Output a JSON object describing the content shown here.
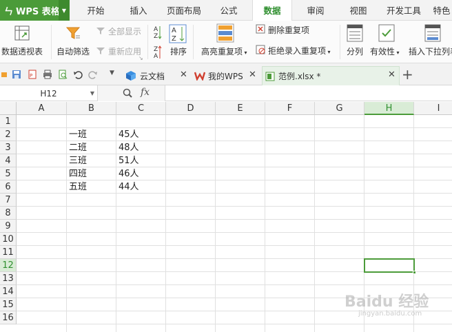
{
  "app": {
    "logo": "ㄣ",
    "name": "WPS 表格"
  },
  "menu": [
    "开始",
    "插入",
    "页面布局",
    "公式",
    "数据",
    "审阅",
    "视图",
    "开发工具",
    "特色"
  ],
  "ribbon": {
    "pivot": "数据透视表",
    "autofilter": "自动筛选",
    "show_all": "全部显示",
    "reapply": "重新应用",
    "sort": "排序",
    "highlight_dup": "高亮重复项",
    "remove_dup": "删除重复项",
    "reject_dup": "拒绝录入重复项",
    "split": "分列",
    "validity": "有效性",
    "insert_dropdown": "插入下拉列表"
  },
  "tabs": [
    {
      "label": "云文档"
    },
    {
      "label": "我的WPS"
    },
    {
      "label": "范例.xlsx *"
    }
  ],
  "formula_bar": {
    "name_box": "H12",
    "fx": "fx",
    "value": ""
  },
  "columns": [
    "A",
    "B",
    "C",
    "D",
    "E",
    "F",
    "G",
    "H",
    "I"
  ],
  "rows": [
    "1",
    "2",
    "3",
    "4",
    "5",
    "6",
    "7",
    "8",
    "9",
    "10",
    "11",
    "12",
    "13",
    "14",
    "15",
    "16"
  ],
  "cells": [
    {
      "ref": "B2",
      "value": "一班"
    },
    {
      "ref": "C2",
      "value": "45人"
    },
    {
      "ref": "B3",
      "value": "二班"
    },
    {
      "ref": "C3",
      "value": "48人"
    },
    {
      "ref": "B4",
      "value": "三班"
    },
    {
      "ref": "C4",
      "value": "51人"
    },
    {
      "ref": "B5",
      "value": "四班"
    },
    {
      "ref": "C5",
      "value": "46人"
    },
    {
      "ref": "B6",
      "value": "五班"
    },
    {
      "ref": "C6",
      "value": "44人"
    }
  ],
  "selected_cell": "H12",
  "watermark": {
    "main": "Baidu 经验",
    "sub": "jingyan.baidu.com"
  },
  "colors": {
    "accent": "#4b9b39",
    "selected_header": "#d9ecd6"
  }
}
